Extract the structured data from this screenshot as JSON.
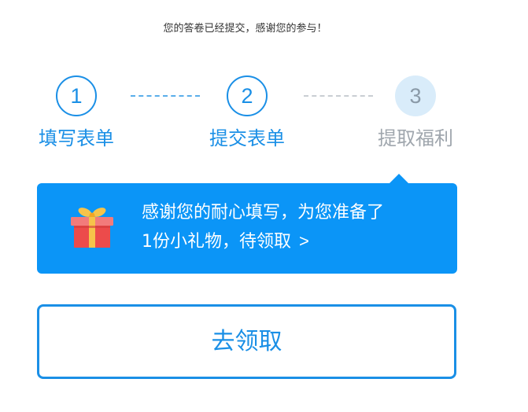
{
  "notice": "您的答卷已经提交，感谢您的参与！",
  "steps": [
    {
      "number": "1",
      "label": "填写表单",
      "state": "completed"
    },
    {
      "number": "2",
      "label": "提交表单",
      "state": "completed"
    },
    {
      "number": "3",
      "label": "提取福利",
      "state": "pending"
    }
  ],
  "gift_card": {
    "icon": "gift-icon",
    "line1": "感谢您的耐心填写，为您准备了",
    "line2": "1份小礼物，待领取",
    "chevron": ">"
  },
  "claim_button": {
    "label": "去领取"
  },
  "colors": {
    "accent": "#1a8fe6",
    "card_background": "#0b95f7",
    "pending_circle": "#d9ecfa",
    "pending_text": "#9fa6ad"
  }
}
